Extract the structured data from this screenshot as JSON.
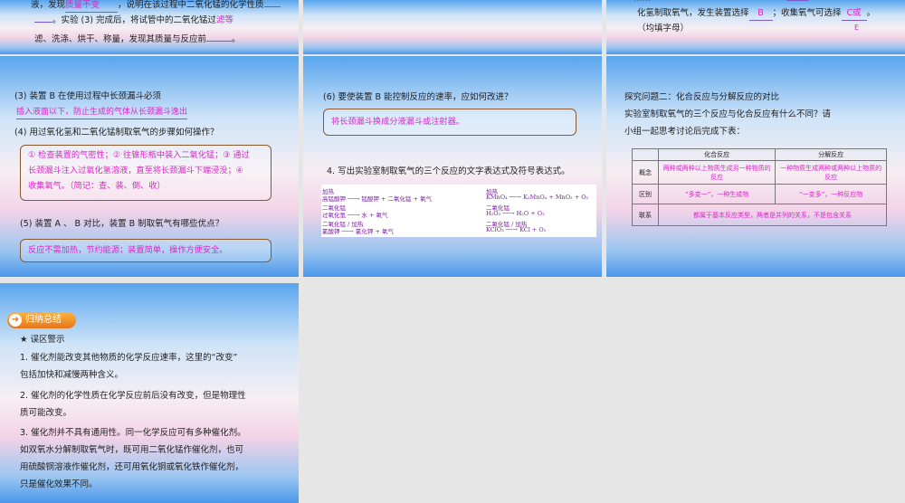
{
  "slide_top1": {
    "line1_pre": "液，发现",
    "line1_blank": "质量不变",
    "line1_post": "，说明在该过程中二氧化锰的化学性质",
    "line2_pre": "。实验 (3) 完成后，将试管中的二氧化锰过",
    "line2_mark": "滤等",
    "line3_pre": "滤、洗涤、烘干、称量，发现其质量与反应前",
    "line3_end": "。"
  },
  "slide_top3": {
    "line1": "化氢制取氧气，发生装置选择",
    "blank_b": "B",
    "line1_mid": "；收集氧气可选择",
    "blank_c": "C或",
    "line1_end": "。",
    "line2": "（均填字母）",
    "stray_e": "E"
  },
  "slide_q3": {
    "q3": "(3) 装置 B 在使用过程中长颈漏斗必须",
    "a3": "插入液面以下，防止生成的气体从长颈漏斗逸出",
    "q4": "(4) 用过氧化氢和二氧化锰制取氧气的步骤如何操作？",
    "a4_l1": "① 检查装置的气密性；② 往锥形瓶中装入二氧化锰；③ 通过",
    "a4_l2": "长颈漏斗注入过氧化氢溶液，直至将长颈漏斗下端浸没；④",
    "a4_l3": "收集氧气。（简记：查、装、倒、收）",
    "q5": "(5) 装置 A 、 B 对比，装置 B 制取氧气有哪些优点？",
    "a5": "反应不需加热，节约能源；装置简单，操作方便安全。"
  },
  "slide_q6": {
    "q6": "(6) 要使装置 B 能控制反应的速率，应如何改进？",
    "a6": "将长颈漏斗换成分液漏斗或注射器。",
    "q7": "4. 写出实验室制取氧气的三个反应的文字表达式及符号表达式。",
    "eq_word": [
      "高锰酸钾 ──→ 锰酸钾 + 二氧化锰 + 氧气",
      "过氧化氢 ──→ 水 + 氧气",
      "氯酸钾 ──→ 氯化钾 + 氧气"
    ],
    "eq_word_cond": [
      "加热",
      "二氧化锰",
      "二氧化锰 / 加热"
    ],
    "eq_sym": [
      "KMnO₄ ──→ K₂MnO₄ + MnO₂ + O₂",
      "H₂O₂ ──→ H₂O + O₂",
      "KClO₃ ──→ KCl + O₂"
    ],
    "eq_sym_cond": [
      "加热",
      "二氧化锰",
      "二氧化锰 / 加热"
    ]
  },
  "slide_explore": {
    "l1": "探究问题二：化合反应与分解反应的对比",
    "l2": "实验室制取氧气的三个反应与化合反应有什么不同？请",
    "l3": "小组一起思考讨论后完成下表：",
    "table": {
      "headers": [
        "",
        "化合反应",
        "分解反应"
      ],
      "row1": [
        "概念",
        "两种或两种以上物质生成另一种物质的反应",
        "一种物质生成两种或两种以上物质的反应"
      ],
      "row2": [
        "区别",
        "“多变一”，一种生成物",
        "“一变多”，一种反应物"
      ],
      "row3": [
        "联系",
        "都属于基本反应类型，两者是并列的关系，不是包含关系"
      ]
    }
  },
  "slide_summary": {
    "badge": "归纳总结",
    "heading": "★ 误区警示",
    "p1_l1": "1. 催化剂能改变其他物质的化学反应速率，这里的“改变”",
    "p1_l2": "包括加快和减慢两种含义。",
    "p2_l1": "2. 催化剂的化学性质在化学反应前后没有改变，但是物理性",
    "p2_l2": "质可能改变。",
    "p3_l1": "3. 催化剂并不具有通用性。同一化学反应可有多种催化剂。",
    "p3_l2": "如双氧水分解制取氧气时，既可用二氧化锰作催化剂，也可",
    "p3_l3": "用硫酸铜溶液作催化剂，还可用氧化铜或氧化铁作催化剂，",
    "p3_l4": "只是催化效果不同。"
  }
}
